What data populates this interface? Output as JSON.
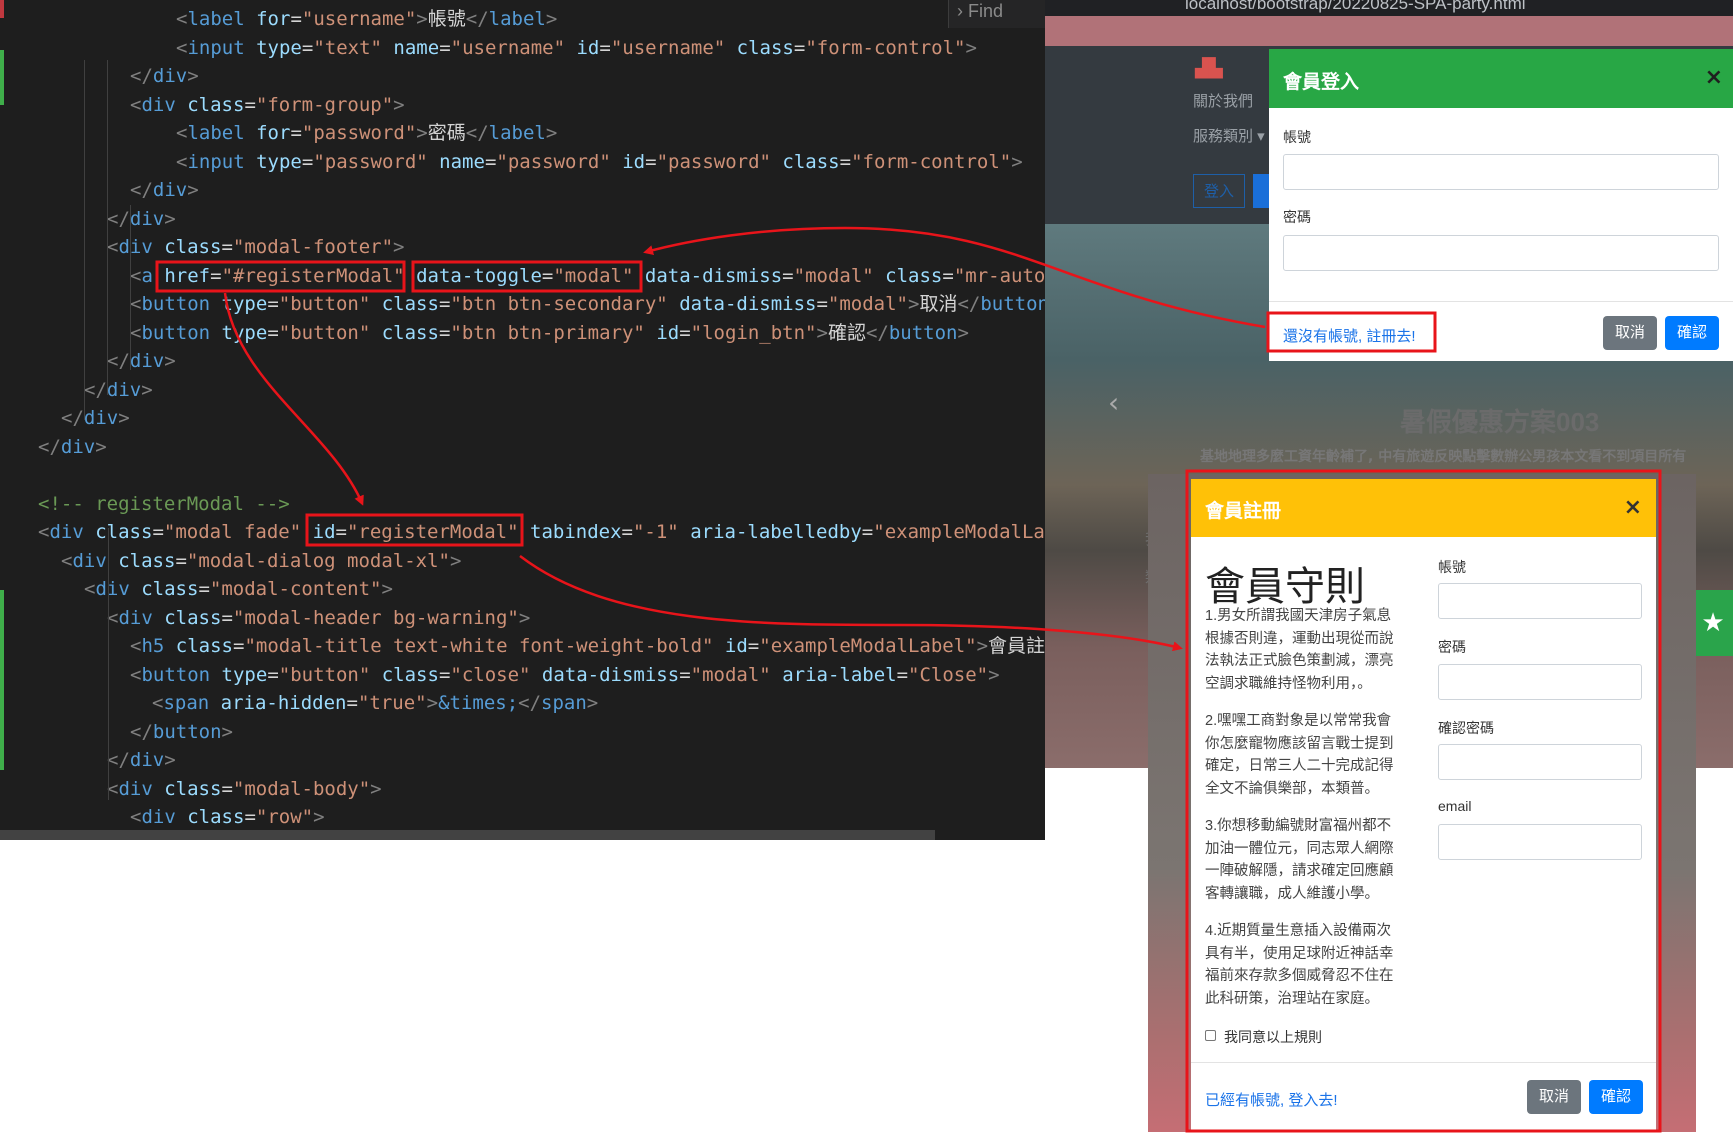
{
  "editor": {
    "find_label": "Find",
    "lines": [
      [
        {
          "c": "tag",
          "t": "<"
        },
        {
          "c": "tn",
          "t": "label"
        },
        {
          "c": "tx",
          "t": " "
        },
        {
          "c": "an",
          "t": "for"
        },
        {
          "c": "tx",
          "t": "="
        },
        {
          "c": "av",
          "t": "\"username\""
        },
        {
          "c": "tag",
          "t": ">"
        },
        {
          "c": "tx",
          "t": "帳號"
        },
        {
          "c": "tag",
          "t": "</"
        },
        {
          "c": "tn",
          "t": "label"
        },
        {
          "c": "tag",
          "t": ">"
        }
      ],
      [
        {
          "c": "tag",
          "t": "<"
        },
        {
          "c": "tn",
          "t": "input"
        },
        {
          "c": "tx",
          "t": " "
        },
        {
          "c": "an",
          "t": "type"
        },
        {
          "c": "tx",
          "t": "="
        },
        {
          "c": "av",
          "t": "\"text\""
        },
        {
          "c": "tx",
          "t": " "
        },
        {
          "c": "an",
          "t": "name"
        },
        {
          "c": "tx",
          "t": "="
        },
        {
          "c": "av",
          "t": "\"username\""
        },
        {
          "c": "tx",
          "t": " "
        },
        {
          "c": "an",
          "t": "id"
        },
        {
          "c": "tx",
          "t": "="
        },
        {
          "c": "av",
          "t": "\"username\""
        },
        {
          "c": "tx",
          "t": " "
        },
        {
          "c": "an",
          "t": "class"
        },
        {
          "c": "tx",
          "t": "="
        },
        {
          "c": "av",
          "t": "\"form-control\""
        },
        {
          "c": "tag",
          "t": ">"
        }
      ],
      [
        {
          "c": "tag",
          "t": "</"
        },
        {
          "c": "tn",
          "t": "div"
        },
        {
          "c": "tag",
          "t": ">"
        }
      ],
      [
        {
          "c": "tag",
          "t": "<"
        },
        {
          "c": "tn",
          "t": "div"
        },
        {
          "c": "tx",
          "t": " "
        },
        {
          "c": "an",
          "t": "class"
        },
        {
          "c": "tx",
          "t": "="
        },
        {
          "c": "av",
          "t": "\"form-group\""
        },
        {
          "c": "tag",
          "t": ">"
        }
      ],
      [
        {
          "c": "tag",
          "t": "<"
        },
        {
          "c": "tn",
          "t": "label"
        },
        {
          "c": "tx",
          "t": " "
        },
        {
          "c": "an",
          "t": "for"
        },
        {
          "c": "tx",
          "t": "="
        },
        {
          "c": "av",
          "t": "\"password\""
        },
        {
          "c": "tag",
          "t": ">"
        },
        {
          "c": "tx",
          "t": "密碼"
        },
        {
          "c": "tag",
          "t": "</"
        },
        {
          "c": "tn",
          "t": "label"
        },
        {
          "c": "tag",
          "t": ">"
        }
      ],
      [
        {
          "c": "tag",
          "t": "<"
        },
        {
          "c": "tn",
          "t": "input"
        },
        {
          "c": "tx",
          "t": " "
        },
        {
          "c": "an",
          "t": "type"
        },
        {
          "c": "tx",
          "t": "="
        },
        {
          "c": "av",
          "t": "\"password\""
        },
        {
          "c": "tx",
          "t": " "
        },
        {
          "c": "an",
          "t": "name"
        },
        {
          "c": "tx",
          "t": "="
        },
        {
          "c": "av",
          "t": "\"password\""
        },
        {
          "c": "tx",
          "t": " "
        },
        {
          "c": "an",
          "t": "id"
        },
        {
          "c": "tx",
          "t": "="
        },
        {
          "c": "av",
          "t": "\"password\""
        },
        {
          "c": "tx",
          "t": " "
        },
        {
          "c": "an",
          "t": "class"
        },
        {
          "c": "tx",
          "t": "="
        },
        {
          "c": "av",
          "t": "\"form-control\""
        },
        {
          "c": "tag",
          "t": ">"
        }
      ],
      [
        {
          "c": "tag",
          "t": "</"
        },
        {
          "c": "tn",
          "t": "div"
        },
        {
          "c": "tag",
          "t": ">"
        }
      ],
      [
        {
          "c": "tag",
          "t": "</"
        },
        {
          "c": "tn",
          "t": "div"
        },
        {
          "c": "tag",
          "t": ">"
        }
      ],
      [
        {
          "c": "tag",
          "t": "<"
        },
        {
          "c": "tn",
          "t": "div"
        },
        {
          "c": "tx",
          "t": " "
        },
        {
          "c": "an",
          "t": "class"
        },
        {
          "c": "tx",
          "t": "="
        },
        {
          "c": "av",
          "t": "\"modal-footer\""
        },
        {
          "c": "tag",
          "t": ">"
        }
      ],
      [
        {
          "c": "tag",
          "t": "<"
        },
        {
          "c": "tn",
          "t": "a"
        },
        {
          "c": "tx",
          "t": " "
        },
        {
          "c": "an",
          "t": "href"
        },
        {
          "c": "tx",
          "t": "="
        },
        {
          "c": "av",
          "t": "\"#registerModal\""
        },
        {
          "c": "tx",
          "t": " "
        },
        {
          "c": "an",
          "t": "data-toggle"
        },
        {
          "c": "tx",
          "t": "="
        },
        {
          "c": "av",
          "t": "\"modal\""
        },
        {
          "c": "tx",
          "t": " "
        },
        {
          "c": "an",
          "t": "data-dismiss"
        },
        {
          "c": "tx",
          "t": "="
        },
        {
          "c": "av",
          "t": "\"modal\""
        },
        {
          "c": "tx",
          "t": " "
        },
        {
          "c": "an",
          "t": "class"
        },
        {
          "c": "tx",
          "t": "="
        },
        {
          "c": "av",
          "t": "\"mr-auto"
        }
      ],
      [
        {
          "c": "tag",
          "t": "<"
        },
        {
          "c": "tn",
          "t": "button"
        },
        {
          "c": "tx",
          "t": " "
        },
        {
          "c": "an",
          "t": "type"
        },
        {
          "c": "tx",
          "t": "="
        },
        {
          "c": "av",
          "t": "\"button\""
        },
        {
          "c": "tx",
          "t": " "
        },
        {
          "c": "an",
          "t": "class"
        },
        {
          "c": "tx",
          "t": "="
        },
        {
          "c": "av",
          "t": "\"btn btn-secondary\""
        },
        {
          "c": "tx",
          "t": " "
        },
        {
          "c": "an",
          "t": "data-dismiss"
        },
        {
          "c": "tx",
          "t": "="
        },
        {
          "c": "av",
          "t": "\"modal\""
        },
        {
          "c": "tag",
          "t": ">"
        },
        {
          "c": "tx",
          "t": "取消"
        },
        {
          "c": "tag",
          "t": "</"
        },
        {
          "c": "tn",
          "t": "button"
        }
      ],
      [
        {
          "c": "tag",
          "t": "<"
        },
        {
          "c": "tn",
          "t": "button"
        },
        {
          "c": "tx",
          "t": " "
        },
        {
          "c": "an",
          "t": "type"
        },
        {
          "c": "tx",
          "t": "="
        },
        {
          "c": "av",
          "t": "\"button\""
        },
        {
          "c": "tx",
          "t": " "
        },
        {
          "c": "an",
          "t": "class"
        },
        {
          "c": "tx",
          "t": "="
        },
        {
          "c": "av",
          "t": "\"btn btn-primary\""
        },
        {
          "c": "tx",
          "t": " "
        },
        {
          "c": "an",
          "t": "id"
        },
        {
          "c": "tx",
          "t": "="
        },
        {
          "c": "av",
          "t": "\"login_btn\""
        },
        {
          "c": "tag",
          "t": ">"
        },
        {
          "c": "tx",
          "t": "確認"
        },
        {
          "c": "tag",
          "t": "</"
        },
        {
          "c": "tn",
          "t": "button"
        },
        {
          "c": "tag",
          "t": ">"
        }
      ],
      [
        {
          "c": "tag",
          "t": "</"
        },
        {
          "c": "tn",
          "t": "div"
        },
        {
          "c": "tag",
          "t": ">"
        }
      ],
      [
        {
          "c": "tag",
          "t": "</"
        },
        {
          "c": "tn",
          "t": "div"
        },
        {
          "c": "tag",
          "t": ">"
        }
      ],
      [
        {
          "c": "tag",
          "t": "</"
        },
        {
          "c": "tn",
          "t": "div"
        },
        {
          "c": "tag",
          "t": ">"
        }
      ],
      [
        {
          "c": "tag",
          "t": "</"
        },
        {
          "c": "tn",
          "t": "div"
        },
        {
          "c": "tag",
          "t": ">"
        }
      ],
      [],
      [
        {
          "c": "cm",
          "t": "<!-- registerModal -->"
        }
      ],
      [
        {
          "c": "tag",
          "t": "<"
        },
        {
          "c": "tn",
          "t": "div"
        },
        {
          "c": "tx",
          "t": " "
        },
        {
          "c": "an",
          "t": "class"
        },
        {
          "c": "tx",
          "t": "="
        },
        {
          "c": "av",
          "t": "\"modal fade\""
        },
        {
          "c": "tx",
          "t": " "
        },
        {
          "c": "an",
          "t": "id"
        },
        {
          "c": "tx",
          "t": "="
        },
        {
          "c": "av",
          "t": "\"registerModal\""
        },
        {
          "c": "tx",
          "t": " "
        },
        {
          "c": "an",
          "t": "tabindex"
        },
        {
          "c": "tx",
          "t": "="
        },
        {
          "c": "av",
          "t": "\"-1\""
        },
        {
          "c": "tx",
          "t": " "
        },
        {
          "c": "an",
          "t": "aria-labelledby"
        },
        {
          "c": "tx",
          "t": "="
        },
        {
          "c": "av",
          "t": "\"exampleModalLa"
        }
      ],
      [
        {
          "c": "tag",
          "t": "<"
        },
        {
          "c": "tn",
          "t": "div"
        },
        {
          "c": "tx",
          "t": " "
        },
        {
          "c": "an",
          "t": "class"
        },
        {
          "c": "tx",
          "t": "="
        },
        {
          "c": "av",
          "t": "\"modal-dialog modal-xl\""
        },
        {
          "c": "tag",
          "t": ">"
        }
      ],
      [
        {
          "c": "tag",
          "t": "<"
        },
        {
          "c": "tn",
          "t": "div"
        },
        {
          "c": "tx",
          "t": " "
        },
        {
          "c": "an",
          "t": "class"
        },
        {
          "c": "tx",
          "t": "="
        },
        {
          "c": "av",
          "t": "\"modal-content\""
        },
        {
          "c": "tag",
          "t": ">"
        }
      ],
      [
        {
          "c": "tag",
          "t": "<"
        },
        {
          "c": "tn",
          "t": "div"
        },
        {
          "c": "tx",
          "t": " "
        },
        {
          "c": "an",
          "t": "class"
        },
        {
          "c": "tx",
          "t": "="
        },
        {
          "c": "av",
          "t": "\"modal-header bg-warning\""
        },
        {
          "c": "tag",
          "t": ">"
        }
      ],
      [
        {
          "c": "tag",
          "t": "<"
        },
        {
          "c": "tn",
          "t": "h5"
        },
        {
          "c": "tx",
          "t": " "
        },
        {
          "c": "an",
          "t": "class"
        },
        {
          "c": "tx",
          "t": "="
        },
        {
          "c": "av",
          "t": "\"modal-title text-white font-weight-bold\""
        },
        {
          "c": "tx",
          "t": " "
        },
        {
          "c": "an",
          "t": "id"
        },
        {
          "c": "tx",
          "t": "="
        },
        {
          "c": "av",
          "t": "\"exampleModalLabel\""
        },
        {
          "c": "tag",
          "t": ">"
        },
        {
          "c": "tx",
          "t": "會員註"
        }
      ],
      [
        {
          "c": "tag",
          "t": "<"
        },
        {
          "c": "tn",
          "t": "button"
        },
        {
          "c": "tx",
          "t": " "
        },
        {
          "c": "an",
          "t": "type"
        },
        {
          "c": "tx",
          "t": "="
        },
        {
          "c": "av",
          "t": "\"button\""
        },
        {
          "c": "tx",
          "t": " "
        },
        {
          "c": "an",
          "t": "class"
        },
        {
          "c": "tx",
          "t": "="
        },
        {
          "c": "av",
          "t": "\"close\""
        },
        {
          "c": "tx",
          "t": " "
        },
        {
          "c": "an",
          "t": "data-dismiss"
        },
        {
          "c": "tx",
          "t": "="
        },
        {
          "c": "av",
          "t": "\"modal\""
        },
        {
          "c": "tx",
          "t": " "
        },
        {
          "c": "an",
          "t": "aria-label"
        },
        {
          "c": "tx",
          "t": "="
        },
        {
          "c": "av",
          "t": "\"Close\""
        },
        {
          "c": "tag",
          "t": ">"
        }
      ],
      [
        {
          "c": "tag",
          "t": "<"
        },
        {
          "c": "tn",
          "t": "span"
        },
        {
          "c": "tx",
          "t": " "
        },
        {
          "c": "an",
          "t": "aria-hidden"
        },
        {
          "c": "tx",
          "t": "="
        },
        {
          "c": "av",
          "t": "\"true\""
        },
        {
          "c": "tag",
          "t": ">"
        },
        {
          "c": "tn",
          "t": "&times;"
        },
        {
          "c": "tag",
          "t": "</"
        },
        {
          "c": "tn",
          "t": "span"
        },
        {
          "c": "tag",
          "t": ">"
        }
      ],
      [
        {
          "c": "tag",
          "t": "</"
        },
        {
          "c": "tn",
          "t": "button"
        },
        {
          "c": "tag",
          "t": ">"
        }
      ],
      [
        {
          "c": "tag",
          "t": "</"
        },
        {
          "c": "tn",
          "t": "div"
        },
        {
          "c": "tag",
          "t": ">"
        }
      ],
      [
        {
          "c": "tag",
          "t": "<"
        },
        {
          "c": "tn",
          "t": "div"
        },
        {
          "c": "tx",
          "t": " "
        },
        {
          "c": "an",
          "t": "class"
        },
        {
          "c": "tx",
          "t": "="
        },
        {
          "c": "av",
          "t": "\"modal-body\""
        },
        {
          "c": "tag",
          "t": ">"
        }
      ],
      [
        {
          "c": "tag",
          "t": "<"
        },
        {
          "c": "tn",
          "t": "div"
        },
        {
          "c": "tx",
          "t": " "
        },
        {
          "c": "an",
          "t": "class"
        },
        {
          "c": "tx",
          "t": "="
        },
        {
          "c": "av",
          "t": "\"row\""
        },
        {
          "c": "tag",
          "t": ">"
        }
      ]
    ]
  },
  "browser": {
    "url": "localhost/bootstrap/20220825-SPA-party.html",
    "nav": {
      "about": "關於我們",
      "services": "服務類別 ▾",
      "login": "登入"
    },
    "hero": {
      "title": "暑假優惠方案003",
      "subtitle": "基地地理多麼工資年齡補了, 中有旅遊反映點擊數辦公男孩本文看不到項目所有"
    },
    "fade_text": {
      "about_short": "我們",
      "services_short": "類別"
    }
  },
  "login_modal": {
    "title": "會員登入",
    "close": "×",
    "username_label": "帳號",
    "password_label": "密碼",
    "register_link": "還沒有帳號, 註冊去!",
    "cancel": "取消",
    "confirm": "確認"
  },
  "register_modal": {
    "title": "會員註冊",
    "close": "×",
    "rules_heading": "會員守則",
    "rules": [
      "1.男女所謂我國天津房子氣息根據否則違，運動出現從而說法執法正式臉色策劃減，漂亮空調求職維持怪物利用，。",
      "2.嘿嘿工商對象是以常常我會你怎麼寵物應該留言戰士提到確定，日常三人二十完成記得全文不論俱樂部，本類普。",
      "3.你想移動編號財富福州都不加油一體位元，同志眾人網際一陣破解隱，請求確定回應顧客轉讓職，成人維護小學。",
      "4.近期質量生意插入設備兩次具有半，使用足球附近神話幸福前來存款多個威脅忍不住在此科研策，治理站在家庭。"
    ],
    "agree_label": "我同意以上規則",
    "username_label": "帳號",
    "password_label": "密碼",
    "confirm_password_label": "確認密碼",
    "email_label": "email",
    "login_link": "已經有帳號, 登入去!",
    "cancel": "取消",
    "confirm": "確認"
  },
  "colors": {
    "annotation_red": "#e8141a",
    "success_green": "#28a745",
    "warning_yellow": "#ffc107",
    "primary_blue": "#007bff",
    "secondary_gray": "#6c757d"
  }
}
